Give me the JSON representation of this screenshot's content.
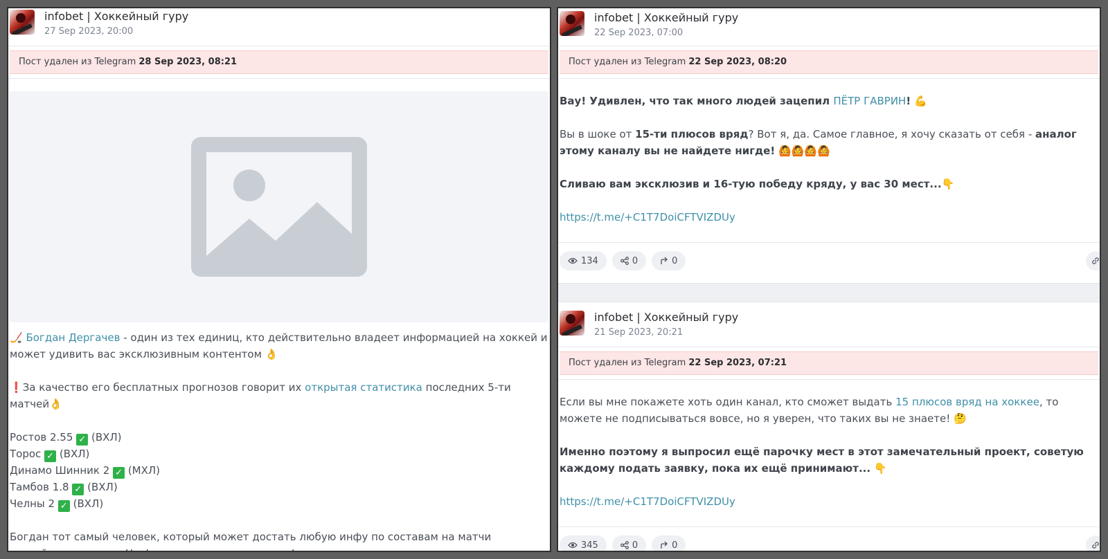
{
  "left_post": {
    "channel": "infobet | Хоккейный гуру",
    "date": "27 Sep 2023, 20:00",
    "deleted_prefix": "Пост удален из Telegram",
    "deleted_date": "28 Sep 2023, 08:21",
    "image_icon": "image-placeholder-icon",
    "p1_emoji": "🏒",
    "p1_link": "Богдан Дергачев",
    "p1_text": " - один из тех единиц, кто действительно владеет информацией на хоккей и может удивить вас эксклюзивным контентом ",
    "p1_emoji_end": "👌",
    "p2_excl": "❗",
    "p2_text": "За качество его бесплатных прогнозов говорит их ",
    "p2_link": "открытая статистика",
    "p2_text2": " последних 5-ти матчей",
    "p2_emoji": "👌",
    "matches": [
      {
        "name": "Ростов 2.55",
        "check": "✓",
        "league": "(ВХЛ)"
      },
      {
        "name": "Торос",
        "check": "✓",
        "league": "(ВХЛ)"
      },
      {
        "name": "Динамо Шинник 2",
        "check": "✓",
        "league": "(МХЛ)"
      },
      {
        "name": "Тамбов 1.8",
        "check": "✓",
        "league": "(ВХЛ)"
      },
      {
        "name": "Челны 2",
        "check": "✓",
        "league": "(ВХЛ)"
      }
    ],
    "p4_text": "Богдан тот самый человек, который может достать любую инфу по составам на матчи российского хоккея. На фото тому доказательство!"
  },
  "right_post_1": {
    "channel": "infobet | Хоккейный гуру",
    "date": "22 Sep 2023, 07:00",
    "deleted_prefix": "Пост удален из Telegram",
    "deleted_date": "22 Sep 2023, 08:20",
    "p1_bold": "Вау! Удивлен, что так много людей зацепил ",
    "p1_link": "ПЁТР ГАВРИН",
    "p1_excl": "!",
    "p1_emoji": "💪",
    "p2_a": "Вы в шоке от ",
    "p2_bold1": "15-ти плюсов вряд",
    "p2_b": "? Вот я, да. Самое главное, я хочу сказать от себя - ",
    "p2_bold2": "аналог этому каналу вы не найдете нигде!",
    "p2_emoji": " 🙆🙆🙆🙆",
    "p3_bold": "Сливаю вам эксклюзив и 16-тую победу кряду, у вас 30 мест...",
    "p3_emoji": "👇",
    "url": "https://t.me/+C1T7DoiCFTVIZDUy",
    "views": "134",
    "shares": "0",
    "forwards": "0"
  },
  "right_post_2": {
    "channel": "infobet | Хоккейный гуру",
    "date": "21 Sep 2023, 20:21",
    "deleted_prefix": "Пост удален из Telegram",
    "deleted_date": "22 Sep 2023, 07:21",
    "p1_a": "Если вы мне покажете хоть один канал, кто сможет выдать ",
    "p1_link": "15 плюсов вряд на хоккее",
    "p1_b": ", то можете не подписываться вовсе, но я уверен, что таких вы не знаете! ",
    "p1_emoji": "🤔",
    "p2_bold": "Именно поэтому я выпросил ещё парочку мест в этот замечательный проект, советую каждому подать заявку, пока их ещё принимают... ",
    "p2_emoji": "👇",
    "url": "https://t.me/+C1T7DoiCFTVIZDUy",
    "views": "345",
    "shares": "0",
    "forwards": "0"
  }
}
